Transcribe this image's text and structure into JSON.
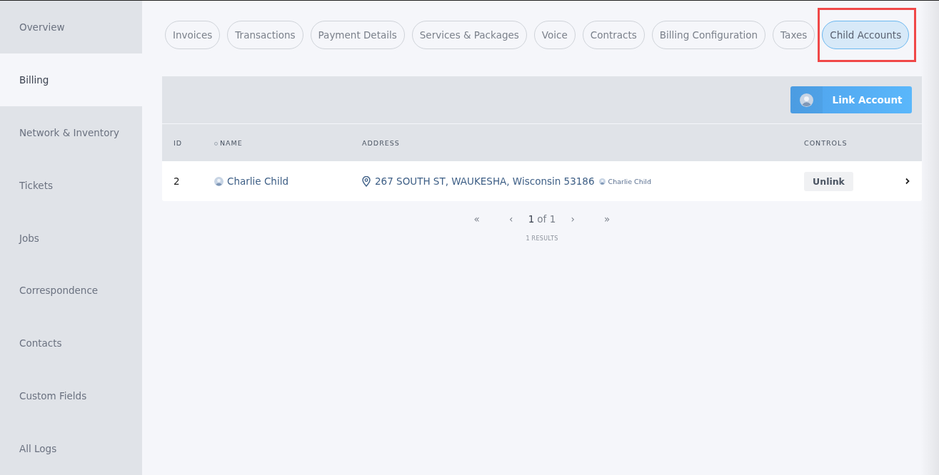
{
  "sidebar": {
    "items": [
      {
        "label": "Overview",
        "selected": false
      },
      {
        "label": "Billing",
        "selected": true
      },
      {
        "label": "Network & Inventory",
        "selected": false
      },
      {
        "label": "Tickets",
        "selected": false
      },
      {
        "label": "Jobs",
        "selected": false
      },
      {
        "label": "Correspondence",
        "selected": false
      },
      {
        "label": "Contacts",
        "selected": false
      },
      {
        "label": "Custom Fields",
        "selected": false
      },
      {
        "label": "All Logs",
        "selected": false
      }
    ]
  },
  "tabs": [
    {
      "label": "Invoices",
      "selected": false,
      "highlighted": false
    },
    {
      "label": "Transactions",
      "selected": false,
      "highlighted": false
    },
    {
      "label": "Payment Details",
      "selected": false,
      "highlighted": false
    },
    {
      "label": "Services & Packages",
      "selected": false,
      "highlighted": false
    },
    {
      "label": "Voice",
      "selected": false,
      "highlighted": false
    },
    {
      "label": "Contracts",
      "selected": false,
      "highlighted": false
    },
    {
      "label": "Billing Configuration",
      "selected": false,
      "highlighted": false
    },
    {
      "label": "Taxes",
      "selected": false,
      "highlighted": false
    },
    {
      "label": "Child Accounts",
      "selected": true,
      "highlighted": true
    }
  ],
  "toolbar": {
    "link_button": "Link Account"
  },
  "table": {
    "columns": [
      "ID",
      "NAME",
      "ADDRESS",
      "CONTROLS"
    ],
    "rows": [
      {
        "id": "2",
        "name": "Charlie Child",
        "address": "267 SOUTH ST, WAUKESHA, Wisconsin 53186",
        "address_owner": "Charlie Child",
        "unlink": "Unlink"
      }
    ]
  },
  "pagination": {
    "first": "«",
    "prev": "‹",
    "current": "1",
    "total": "of 1",
    "next": "›",
    "last": "»",
    "results": "1 RESULTS"
  }
}
